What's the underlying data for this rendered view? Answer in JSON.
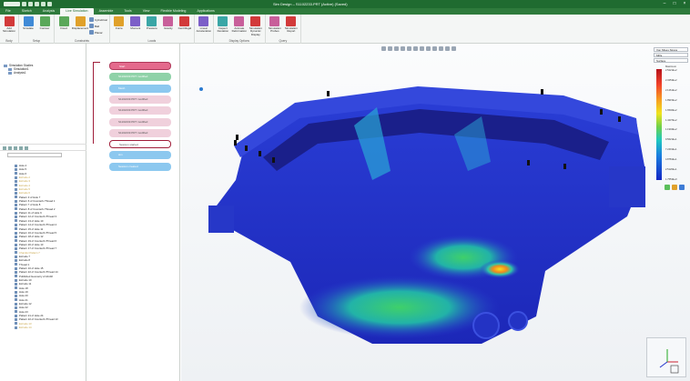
{
  "titlebar": {
    "title": "Sim Design – S1102233.PRT (Active) (Saved)"
  },
  "tabs": [
    "File",
    "Sketch",
    "Analysis",
    "Live Simulation",
    "Assemble",
    "Tools",
    "View",
    "Flexible Modeling",
    "Applications"
  ],
  "active_tab": "Live Simulation",
  "ribbon": {
    "groups": [
      {
        "name": "Body",
        "buttons": [
          "Add Simulation"
        ]
      },
      {
        "name": "Setup",
        "buttons": [
          "Simulate",
          "Contour"
        ]
      },
      {
        "name": "Constraints",
        "buttons": [
          "Fixed",
          "Displacement"
        ],
        "small": [
          "Cylindrical",
          "Ball",
          "Planar"
        ]
      },
      {
        "name": "Loads",
        "buttons": [
          "Force",
          "Moment",
          "Pressure",
          "Gravity",
          "Centrifugal"
        ]
      },
      {
        "name": "",
        "buttons": [
          "Linear Acceleration"
        ]
      },
      {
        "name": "Display Options",
        "buttons": [
          "Inspect Deviation",
          "Animate Deformation",
          "Simulation Dynamic Display"
        ]
      },
      {
        "name": "Query",
        "buttons": [
          "Simulation Probes",
          "Simulation Report"
        ]
      }
    ]
  },
  "model_tree": {
    "items": [
      "Simulation Studies",
      "Simulation1",
      "Analysis1"
    ]
  },
  "timeline": {
    "steps": [
      {
        "label": "Start",
        "kind": "red"
      },
      {
        "label": "S1102233.PRT modified",
        "kind": "green"
      },
      {
        "label": "Mesh",
        "kind": "blue"
      },
      {
        "label": "S1102233.PRT modified",
        "kind": "pink"
      },
      {
        "label": "S1102233.PRT modified",
        "kind": "pink"
      },
      {
        "label": "S1102233.PRT modified",
        "kind": "pink"
      },
      {
        "label": "S1102233.PRT modified",
        "kind": "pink"
      },
      {
        "label": "Session started",
        "kind": "outline"
      },
      {
        "label": "sim",
        "kind": "blue"
      },
      {
        "label": "Session created",
        "kind": "blue"
      }
    ]
  },
  "parts_list": {
    "items": [
      "Hole 4",
      "Hole 5",
      "Hole 6",
      "Extrude 2",
      "Extrude 3",
      "Extrude 4",
      "Extrude 5",
      "Extrude 6",
      "Pattern 3 of Hole 7",
      "Pattern 6 of Counterb./Thread 1",
      "Pattern 7 of Hole 8",
      "Pattern 8 of Counterb./Thread 2",
      "Pattern 11 of Hole 9",
      "Pattern 12 of Counterb./Thread 3",
      "Pattern 13 of Hole 10",
      "Pattern 14 of Counterb./Thread 4",
      "Pattern 15 of Hole 11",
      "Pattern 16 of Counterb./Thread 5",
      "Pattern 18 of Hole 12",
      "Pattern 19 of Counterb./Thread 6",
      "Pattern 20 of Hole 13",
      "Pattern 17 of Counterb./Thread 7",
      "Chamfer Pattern 7",
      "Extrude 7",
      "Extrude 8",
      "Thread 1",
      "Pattern 10 of Hole 15",
      "Pattern 22 of Counterb./Thread 14",
      "Published Geometry of A1102",
      "Extrude 10",
      "Extrude 11",
      "Hole 18",
      "Hole 19",
      "Hole 20",
      "Hole 21",
      "Extrude 12",
      "Hole 22",
      "Hole 23",
      "Pattern 21 of Hole 24",
      "Pattern 22 of Counterb./Thread 13",
      "Extrude 13",
      "Extrude 14"
    ],
    "dim_indices": [
      3,
      4,
      5,
      6,
      7,
      22,
      40,
      41
    ]
  },
  "legend": {
    "quantity": "Von Mises Stress",
    "units": "MPa",
    "display": "Surface",
    "max_label": "Maximum",
    "values": [
      "2.5221E+2",
      "2.3253E+2",
      "2.1261E+2",
      "1.8915E+2",
      "1.6546E+2",
      "1.4237E+2",
      "1.1904E+2",
      "9.5621E+1",
      "7.2401E+1",
      "4.8781E+1",
      "2.5120E+1",
      "1.7553E+0"
    ]
  },
  "colors": {
    "accent": "#2e7a3c",
    "timeline": "#a01e3a"
  }
}
